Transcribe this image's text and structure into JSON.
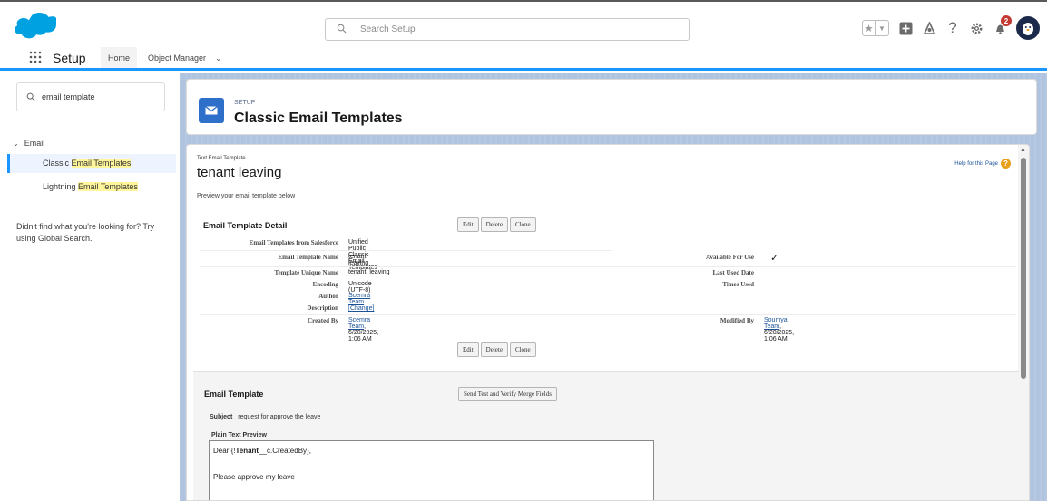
{
  "header": {
    "search_placeholder": "Search Setup",
    "notification_count": "2",
    "icons": [
      "star-icon",
      "chevron-down-icon",
      "add-icon",
      "trailhead-icon",
      "help-icon",
      "gear-icon",
      "bell-icon",
      "avatar-icon"
    ]
  },
  "nav": {
    "app_name": "Setup",
    "tabs": [
      {
        "label": "Home"
      },
      {
        "label": "Object Manager"
      }
    ]
  },
  "sidebar": {
    "quick_find_value": "email template",
    "tree_section": "Email",
    "items": [
      {
        "pre": "Classic ",
        "match": "Email Templates",
        "selected": true
      },
      {
        "pre": "Lightning ",
        "match": "Email Templates",
        "selected": false
      }
    ],
    "hint": "Didn't find what you're looking for? Try using Global Search."
  },
  "page_header": {
    "eyebrow": "SETUP",
    "title": "Classic Email Templates"
  },
  "record": {
    "crumb": "Text Email Template",
    "name": "tenant leaving",
    "preview_text": "Preview your email template below",
    "help_link": "Help for this Page"
  },
  "detail": {
    "title": "Email Template Detail",
    "buttons": [
      "Edit",
      "Delete",
      "Clone"
    ],
    "fields_left": [
      {
        "label": "Email Templates from Salesforce",
        "value": "Unified Public Classic Email Templates",
        "link": false
      },
      {
        "label": "Email Template Name",
        "value": "tenant leaving",
        "link": false
      },
      {
        "label": "Template Unique Name",
        "value": "tenant_leaving",
        "link": false
      },
      {
        "label": "Encoding",
        "value": "Unicode (UTF-8)",
        "link": false
      },
      {
        "label": "Author",
        "value": "Scemra Team [Change]",
        "link": true
      },
      {
        "label": "Description",
        "value": "",
        "link": false
      },
      {
        "label": "Created By",
        "value": "Scemra Team",
        "value2": ", 6/20/2025, 1:06 AM",
        "link": true
      }
    ],
    "fields_right": [
      {
        "label": "Available For Use",
        "value": "✓"
      },
      {
        "label": "Last Used Date",
        "value": ""
      },
      {
        "label": "Times Used",
        "value": ""
      },
      {
        "label": "Modified By",
        "value": "Soumya Team",
        "value2": ", 6/20/2025, 1:06 AM"
      }
    ]
  },
  "email_template": {
    "title": "Email Template",
    "button": "Send Test and Verify Merge Fields",
    "subject_label": "Subject",
    "subject_value": "request for approve the leave",
    "plain_text_label": "Plain Text Preview",
    "body_line1_pre": "Dear {!",
    "body_line1_bold": "Tenant",
    "body_line1_post": "__c.CreatedBy},",
    "body_line2": "Please approve my leave"
  },
  "colors": {
    "brand_blue": "#1b96ff",
    "header_icon_blue": "#2e6fc9",
    "link_blue": "#1b5297",
    "background_band": "#b0c4df"
  }
}
